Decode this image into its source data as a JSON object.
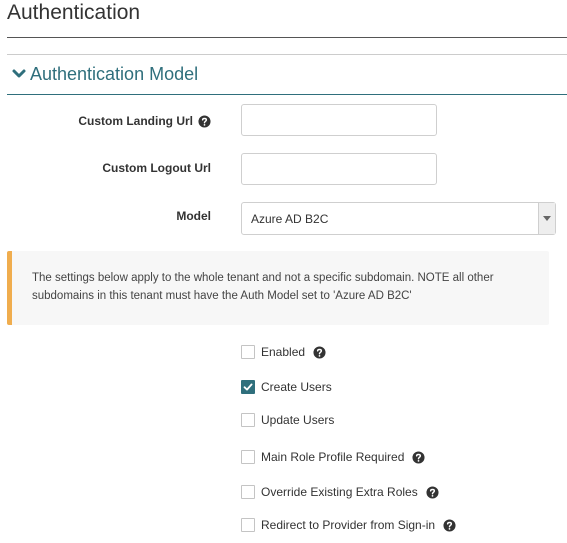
{
  "page": {
    "title": "Authentication"
  },
  "section": {
    "title": "Authentication Model"
  },
  "form": {
    "custom_landing_url": {
      "label": "Custom Landing Url",
      "value": "",
      "placeholder": ""
    },
    "custom_logout_url": {
      "label": "Custom Logout Url",
      "value": "",
      "placeholder": ""
    },
    "model": {
      "label": "Model",
      "value": "Azure AD B2C"
    }
  },
  "notice": {
    "text": "The settings below apply to the whole tenant and not a specific subdomain. NOTE all other subdomains in this tenant must have the Auth Model set to 'Azure AD B2C'"
  },
  "options": [
    {
      "label": "Enabled",
      "checked": false,
      "has_help": true
    },
    {
      "label": "Create Users",
      "checked": true,
      "has_help": false
    },
    {
      "label": "Update Users",
      "checked": false,
      "has_help": false
    },
    {
      "label": "Main Role Profile Required",
      "checked": false,
      "has_help": true
    },
    {
      "label": "Override Existing Extra Roles",
      "checked": false,
      "has_help": true
    },
    {
      "label": "Redirect to Provider from Sign-in",
      "checked": false,
      "has_help": true
    }
  ],
  "colors": {
    "accent": "#2f6f7c",
    "warning": "#f0ad4e",
    "notice_bg": "#f7f7f7"
  },
  "icons": {
    "section_toggle": "chevron-down-icon",
    "help": "question-circle-icon",
    "check": "check-icon",
    "dropdown": "caret-down-icon"
  }
}
